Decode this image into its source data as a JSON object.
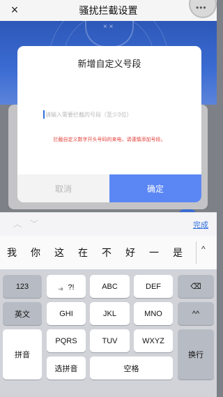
{
  "app": {
    "title": "骚扰拦截设置",
    "close_icon": "×",
    "more_icon": "•••"
  },
  "dialog": {
    "title": "新增自定义号段",
    "input": {
      "value": "",
      "placeholder": "请输入需要拦截的号段（至少3位）"
    },
    "hint": "拦截自定义数字开头号码的来电，请谨慎添加号段。",
    "cancel_label": "取消",
    "confirm_label": "确定"
  },
  "keyboard_toolbar": {
    "done_label": "完成",
    "chevron_up": "︿",
    "chevron_down": "﹀"
  },
  "keyboard": {
    "candidates": [
      "我",
      "你",
      "这",
      "在",
      "不",
      "好",
      "一",
      "是"
    ],
    "expand_icon": "^",
    "rows": [
      [
        "123",
        ".。?!",
        "ABC",
        "DEF",
        "⌫"
      ],
      [
        "英文",
        "GHI",
        "JKL",
        "MNO",
        "^^"
      ],
      [
        "拼音",
        "PQRS",
        "TUV",
        "WXYZ",
        "换行"
      ],
      [
        "选拼音",
        "空格"
      ]
    ]
  }
}
